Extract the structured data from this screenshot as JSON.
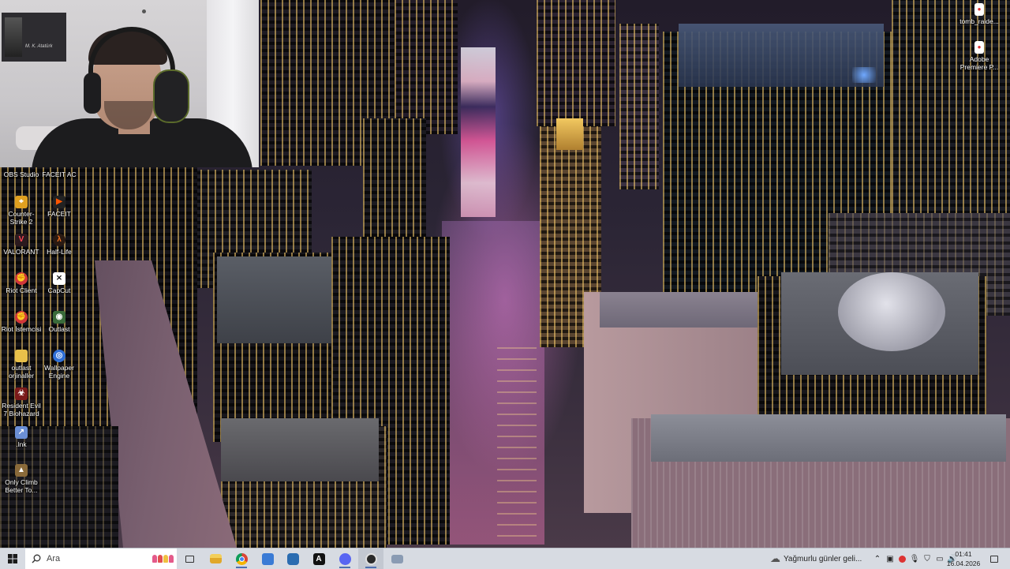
{
  "desktop": {
    "icons_left": [
      {
        "label": "OBS Studio",
        "icon": "obs-icon",
        "color": "#2a2a2a"
      },
      {
        "label": "FACEIT AC",
        "icon": "faceit-ac-icon",
        "color": "#ff5500"
      },
      {
        "label": "Counter-Strike 2",
        "icon": "counter-strike-icon",
        "color": "#e0a020"
      },
      {
        "label": "FACEIT",
        "icon": "faceit-icon",
        "color": "#ff5500"
      },
      {
        "label": "VALORANT",
        "icon": "valorant-icon",
        "color": "#ff4655"
      },
      {
        "label": "Half-Life",
        "icon": "half-life-icon",
        "color": "#f07020"
      },
      {
        "label": "Riot Client",
        "icon": "riot-client-icon",
        "color": "#d13639"
      },
      {
        "label": "CapCut",
        "icon": "capcut-icon",
        "color": "#111111"
      },
      {
        "label": "Riot İstemcisi",
        "icon": "riot-client-icon",
        "color": "#d13639"
      },
      {
        "label": "Outlast",
        "icon": "outlast-icon",
        "color": "#3a6b3a"
      },
      {
        "label": "outlast orjinaller",
        "icon": "folder-icon",
        "color": "#e8c04a"
      },
      {
        "label": "Wallpaper Engine",
        "icon": "wallpaper-engine-icon",
        "color": "#2f6fd6"
      },
      {
        "label": "Resident Evil 7 Biohazard",
        "icon": "resident-evil-icon",
        "color": "#7a1a1a"
      },
      {
        "label": ".lnk",
        "icon": "shortcut-icon",
        "color": "#6b8fd6"
      },
      {
        "label": "Only Climb Better To...",
        "icon": "only-climb-icon",
        "color": "#8a6a3a"
      }
    ],
    "icons_right": [
      {
        "label": "tomb_raide...",
        "icon": "file-icon",
        "color": "#ffffff"
      },
      {
        "label": "Adobe Premiere P...",
        "icon": "file-icon",
        "color": "#ffffff"
      }
    ]
  },
  "webcam": {
    "poster_text": "M. K. Atatürk"
  },
  "taskbar": {
    "search_placeholder": "Ara",
    "pinned": [
      {
        "name": "task-view-icon",
        "color": "#333333"
      },
      {
        "name": "file-explorer-icon",
        "color": "#e8b73a"
      },
      {
        "name": "chrome-icon",
        "color": "#db4437"
      },
      {
        "name": "microsoft-store-icon",
        "color": "#3a7bd5"
      },
      {
        "name": "mail-icon",
        "color": "#2b6cb0"
      },
      {
        "name": "text-app-icon",
        "color": "#111111"
      },
      {
        "name": "discord-icon",
        "color": "#5865f2"
      },
      {
        "name": "obs-icon",
        "color": "#2a2a2a"
      },
      {
        "name": "folder-window-icon",
        "color": "#8a9bb3"
      }
    ],
    "weather_text": "Yağmurlu günler geli...",
    "time": "01:41",
    "date": "16.04.2026"
  }
}
